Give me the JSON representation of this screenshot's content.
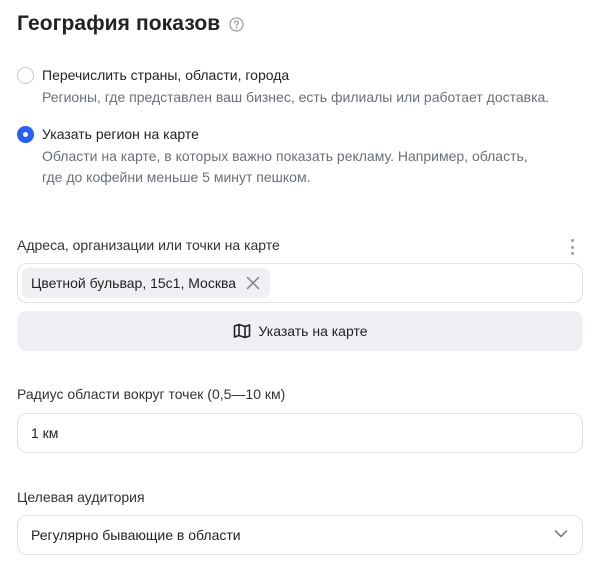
{
  "header": {
    "title": "География показов",
    "help_icon": "question-circle-icon"
  },
  "geo_options": [
    {
      "label": "Перечислить страны, области, города",
      "description": "Регионы, где представлен ваш бизнес, есть филиалы или работает доставка.",
      "selected": false
    },
    {
      "label": "Указать регион на карте",
      "description_line1": "Области на карте, в которых важно показать рекламу. Например, область,",
      "description_line2": "где до кофейни меньше 5 минут пешком.",
      "selected": true
    }
  ],
  "addresses": {
    "label": "Адреса, организации или точки на карте",
    "chips": [
      "Цветной бульвар, 15с1, Москва"
    ],
    "map_button_label": "Указать на карте",
    "map_icon": "map-icon"
  },
  "radius": {
    "label": "Радиус области вокруг точек (0,5—10 км)",
    "value": "1 км"
  },
  "audience": {
    "label": "Целевая аудитория",
    "selected": "Регулярно бывающие в области"
  },
  "colors": {
    "accent": "#2a5df5",
    "muted_text": "#6b6f76",
    "button_bg": "#eef0f3",
    "border": "#dfe1e5"
  }
}
